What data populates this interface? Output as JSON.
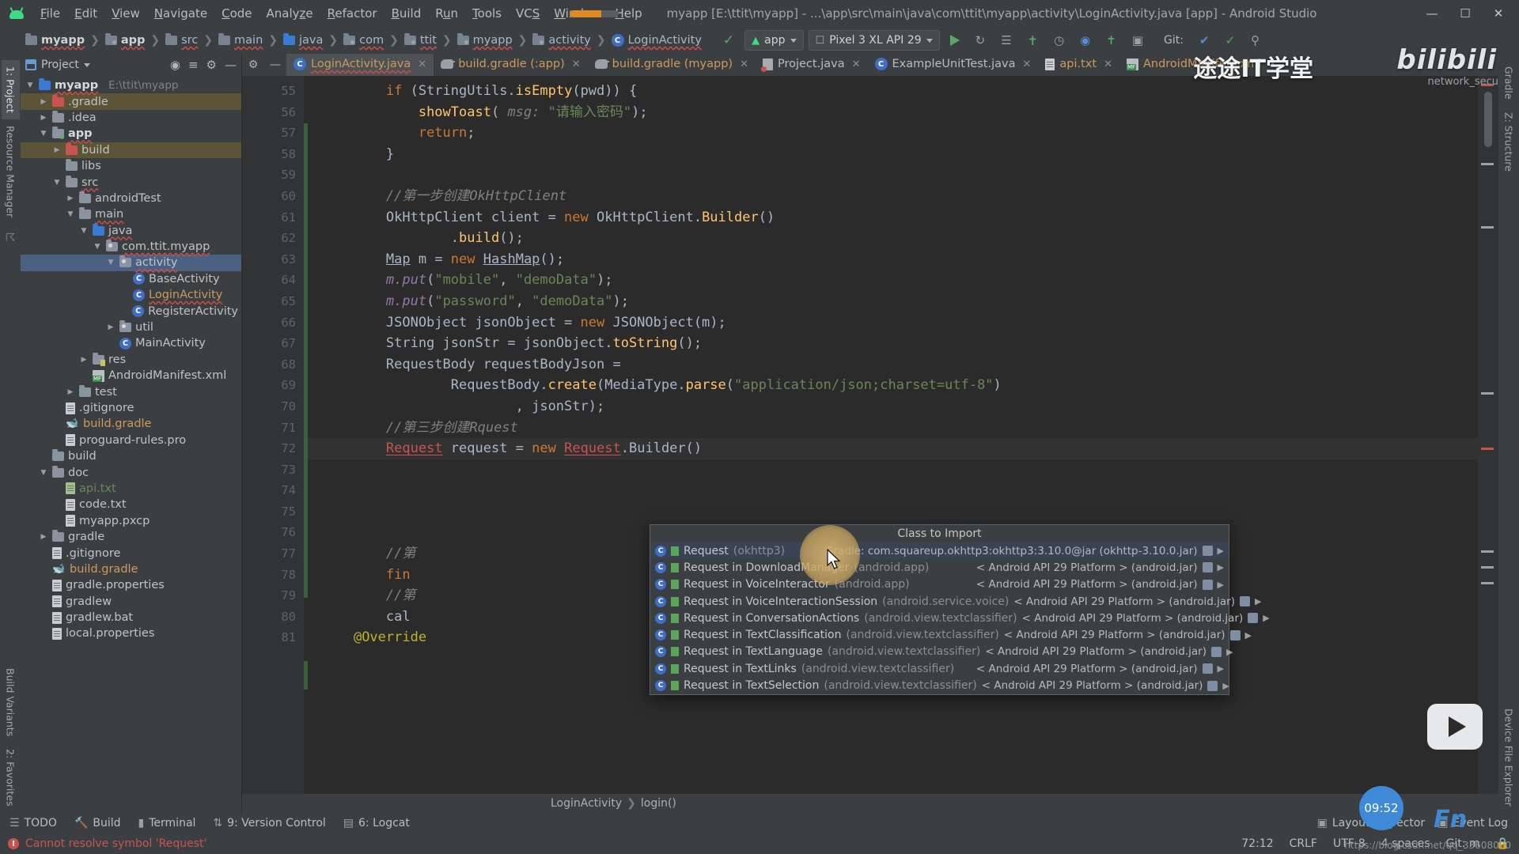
{
  "window": {
    "title": "myapp [E:\\ttit\\myapp] - ...\\app\\src\\main\\java\\com\\ttit\\myapp\\activity\\LoginActivity.java [app] - Android Studio",
    "minimize": "—",
    "maximize": "☐",
    "close": "✕"
  },
  "menu": [
    {
      "label": "File",
      "mn": "F"
    },
    {
      "label": "Edit",
      "mn": "E"
    },
    {
      "label": "View",
      "mn": "V"
    },
    {
      "label": "Navigate",
      "mn": "N"
    },
    {
      "label": "Code",
      "mn": "C"
    },
    {
      "label": "Analyze",
      "mn": "z"
    },
    {
      "label": "Refactor",
      "mn": "R"
    },
    {
      "label": "Build",
      "mn": "B"
    },
    {
      "label": "Run",
      "mn": "u"
    },
    {
      "label": "Tools",
      "mn": "T"
    },
    {
      "label": "VCS",
      "mn": "S"
    },
    {
      "label": "Window",
      "mn": "W"
    },
    {
      "label": "Help",
      "mn": "H"
    }
  ],
  "breadcrumb": [
    {
      "label": "myapp",
      "type": "folder",
      "bold": true
    },
    {
      "label": "app",
      "type": "folder-mod",
      "bold": true
    },
    {
      "label": "src",
      "type": "folder"
    },
    {
      "label": "main",
      "type": "folder"
    },
    {
      "label": "java",
      "type": "folder-blue"
    },
    {
      "label": "com",
      "type": "package"
    },
    {
      "label": "ttit",
      "type": "package"
    },
    {
      "label": "myapp",
      "type": "package"
    },
    {
      "label": "activity",
      "type": "package"
    },
    {
      "label": "LoginActivity",
      "type": "class"
    }
  ],
  "toolbar": {
    "module_selector": "app",
    "device_selector": "Pixel 3 XL API 29",
    "run_icon": "run-icon",
    "debug_icon": "debug-icon",
    "git_label": "Git:",
    "icons": [
      "build-hammer-icon",
      "run-icon",
      "rerun-icon",
      "stop-icon",
      "avd-manager-icon",
      "sdk-manager-icon",
      "profiler-icon",
      "layout-inspector-icon",
      "attach-debugger-icon",
      "sync-gradle-icon",
      "search-icon"
    ]
  },
  "project_panel": {
    "title": "Project",
    "icons": [
      "locate-icon",
      "collapse-all-icon",
      "settings-icon",
      "hide-icon"
    ],
    "tree": [
      {
        "depth": 0,
        "arrow": "▼",
        "icon": "folder-module",
        "label": "myapp",
        "bold": true,
        "path": "E:\\ttit\\myapp",
        "wav": true
      },
      {
        "depth": 1,
        "arrow": "▶",
        "icon": "folder-red",
        "label": ".gradle",
        "highlight": true
      },
      {
        "depth": 1,
        "arrow": "▶",
        "icon": "folder",
        "label": ".idea"
      },
      {
        "depth": 1,
        "arrow": "▼",
        "icon": "folder-mod",
        "label": "app",
        "bold": true,
        "wav": true
      },
      {
        "depth": 2,
        "arrow": "▶",
        "icon": "folder-red",
        "label": "build",
        "highlight": true
      },
      {
        "depth": 2,
        "arrow": "",
        "icon": "folder",
        "label": "libs"
      },
      {
        "depth": 2,
        "arrow": "▼",
        "icon": "folder",
        "label": "src",
        "wav": true
      },
      {
        "depth": 3,
        "arrow": "▶",
        "icon": "folder",
        "label": "androidTest"
      },
      {
        "depth": 3,
        "arrow": "▼",
        "icon": "folder",
        "label": "main",
        "wav": true
      },
      {
        "depth": 4,
        "arrow": "▼",
        "icon": "folder-blue",
        "label": "java",
        "wav": true
      },
      {
        "depth": 5,
        "arrow": "▼",
        "icon": "package",
        "label": "com.ttit.myapp",
        "wav": true
      },
      {
        "depth": 6,
        "arrow": "▼",
        "icon": "package",
        "label": "activity",
        "selected": true,
        "wav": true
      },
      {
        "depth": 7,
        "arrow": "",
        "icon": "class",
        "label": "BaseActivity"
      },
      {
        "depth": 7,
        "arrow": "",
        "icon": "class",
        "label": "LoginActivity",
        "wav": true,
        "open": true
      },
      {
        "depth": 7,
        "arrow": "",
        "icon": "class",
        "label": "RegisterActivity"
      },
      {
        "depth": 6,
        "arrow": "▶",
        "icon": "package",
        "label": "util"
      },
      {
        "depth": 6,
        "arrow": "",
        "icon": "class",
        "label": "MainActivity"
      },
      {
        "depth": 4,
        "arrow": "▶",
        "icon": "folder-res",
        "label": "res"
      },
      {
        "depth": 4,
        "arrow": "",
        "icon": "manifest",
        "label": "AndroidManifest.xml"
      },
      {
        "depth": 3,
        "arrow": "▶",
        "icon": "folder",
        "label": "test"
      },
      {
        "depth": 2,
        "arrow": "",
        "icon": "gitignore",
        "label": ".gitignore"
      },
      {
        "depth": 2,
        "arrow": "",
        "icon": "gradle",
        "label": "build.gradle"
      },
      {
        "depth": 2,
        "arrow": "",
        "icon": "doc",
        "label": "proguard-rules.pro"
      },
      {
        "depth": 1,
        "arrow": "",
        "icon": "folder",
        "label": "build"
      },
      {
        "depth": 1,
        "arrow": "▼",
        "icon": "folder",
        "label": "doc"
      },
      {
        "depth": 2,
        "arrow": "",
        "icon": "doc-green",
        "label": "api.txt"
      },
      {
        "depth": 2,
        "arrow": "",
        "icon": "doc",
        "label": "code.txt"
      },
      {
        "depth": 2,
        "arrow": "",
        "icon": "doc-unknown",
        "label": "myapp.pxcp"
      },
      {
        "depth": 1,
        "arrow": "▶",
        "icon": "folder",
        "label": "gradle"
      },
      {
        "depth": 1,
        "arrow": "",
        "icon": "gitignore",
        "label": ".gitignore"
      },
      {
        "depth": 1,
        "arrow": "",
        "icon": "gradle",
        "label": "build.gradle"
      },
      {
        "depth": 1,
        "arrow": "",
        "icon": "props",
        "label": "gradle.properties"
      },
      {
        "depth": 1,
        "arrow": "",
        "icon": "script",
        "label": "gradlew"
      },
      {
        "depth": 1,
        "arrow": "",
        "icon": "script",
        "label": "gradlew.bat"
      },
      {
        "depth": 1,
        "arrow": "",
        "icon": "props",
        "label": "local.properties"
      }
    ]
  },
  "left_rail": [
    {
      "label": "1: Project",
      "selected": true
    },
    {
      "label": "Resource Manager"
    },
    {
      "label": "Build Variants"
    },
    {
      "label": "2: Favorites"
    }
  ],
  "right_rail": [
    {
      "label": "Gradle"
    },
    {
      "label": "Z: Structure"
    },
    {
      "label": "Device File Explorer"
    }
  ],
  "editor_tabs": [
    {
      "label": "LoginActivity.java",
      "icon": "java-class-icon",
      "active": true,
      "close": "✕"
    },
    {
      "label": "build.gradle (:app)",
      "icon": "gradle-icon",
      "active": false,
      "close": "✕"
    },
    {
      "label": "build.gradle (myapp)",
      "icon": "gradle-icon",
      "active": false,
      "close": "✕"
    },
    {
      "label": "Project.java",
      "icon": "java-file-icon",
      "active": false,
      "close": "✕"
    },
    {
      "label": "ExampleUnitTest.java",
      "icon": "java-test-icon",
      "active": false,
      "close": "✕"
    },
    {
      "label": "api.txt",
      "icon": "text-file-icon",
      "active": false,
      "close": "✕"
    },
    {
      "label": "AndroidManifest.xml",
      "icon": "manifest-icon",
      "active": false,
      "close": "✕"
    }
  ],
  "code": {
    "first_line_number": 55,
    "lines": [
      {
        "n": 55,
        "html": "        <span class=\"kw\">if</span> (StringUtils.<span class=\"meth\">isEmpty</span>(pwd)) {"
      },
      {
        "n": 56,
        "html": "            <span class=\"meth\">showToast</span>( <span class=\"cmt\">msg:</span> <span class=\"str\">\"请输入密码\"</span>);"
      },
      {
        "n": 57,
        "html": "            <span class=\"kw\">return</span>;"
      },
      {
        "n": 58,
        "html": "        }"
      },
      {
        "n": 59,
        "html": ""
      },
      {
        "n": 60,
        "html": "        <span class=\"cmt\">//第一步创建OkHttpClient</span>"
      },
      {
        "n": 61,
        "html": "        OkHttpClient client = <span class=\"kw\">new</span> OkHttpClient.<span class=\"meth\">Builder</span>()"
      },
      {
        "n": 62,
        "html": "                .<span class=\"meth\">build</span>();"
      },
      {
        "n": 63,
        "html": "        <span class=\"stat\">Map</span> m = <span class=\"kw\">new</span> <span class=\"stat\">HashMap</span>();"
      },
      {
        "n": 64,
        "html": "        <span class=\"fld\">m.put</span>(<span class=\"str\">\"mobile\"</span>, <span class=\"str\">\"demoData\"</span>);"
      },
      {
        "n": 65,
        "html": "        <span class=\"fld\">m.put</span>(<span class=\"str\">\"password\"</span>, <span class=\"str\">\"demoData\"</span>);"
      },
      {
        "n": 66,
        "html": "        JSONObject jsonObject = <span class=\"kw\">new</span> JSONObject(m);"
      },
      {
        "n": 67,
        "html": "        String jsonStr = jsonObject.<span class=\"meth\">toString</span>();"
      },
      {
        "n": 68,
        "html": "        RequestBody requestBodyJson ="
      },
      {
        "n": 69,
        "html": "                RequestBody.<span class=\"meth\">create</span>(MediaType.<span class=\"meth\">parse</span>(<span class=\"str\">\"application/json;charset=utf-8\"</span>)"
      },
      {
        "n": 70,
        "html": "                        , jsonStr);"
      },
      {
        "n": 71,
        "html": "        <span class=\"cmt\">//第三步创建Rquest</span>"
      },
      {
        "n": 72,
        "html": "        <span class=\"err\">Request</span> request = <span class=\"kw\">new</span> <span class=\"err\">Request</span>.Builder()",
        "current": true
      },
      {
        "n": 73,
        "html": ""
      },
      {
        "n": 74,
        "html": ""
      },
      {
        "n": 75,
        "html": ""
      },
      {
        "n": 76,
        "html": ""
      },
      {
        "n": 77,
        "html": "        <span class=\"cmt\">//第</span>"
      },
      {
        "n": 78,
        "html": "        <span class=\"kw\">fin</span>"
      },
      {
        "n": 79,
        "html": "        <span class=\"cmt\">//第</span>"
      },
      {
        "n": 80,
        "html": "        cal"
      },
      {
        "n": 81,
        "html": "    <span class=\"anno\">@Override</span>"
      }
    ]
  },
  "popup": {
    "header": "Class to Import",
    "rows": [
      {
        "name": "Request",
        "pkg": " (okhttp3)",
        "right": "Gradle: com.squareup.okhttp3:okhttp3:3.10.0@jar (okhttp-3.10.0.jar)",
        "selected": true
      },
      {
        "name": "Request in DownloadManager",
        "pkg": " (android.app)",
        "right": "< Android API 29 Platform > (android.jar)"
      },
      {
        "name": "Request in VoiceInteractor",
        "pkg": " (android.app)",
        "right": "< Android API 29 Platform > (android.jar)"
      },
      {
        "name": "Request in VoiceInteractionSession",
        "pkg": " (android.service.voice)",
        "right": "< Android API 29 Platform > (android.jar)"
      },
      {
        "name": "Request in ConversationActions",
        "pkg": " (android.view.textclassifier)",
        "right": "< Android API 29 Platform > (android.jar)"
      },
      {
        "name": "Request in TextClassification",
        "pkg": " (android.view.textclassifier)",
        "right": "< Android API 29 Platform > (android.jar)"
      },
      {
        "name": "Request in TextLanguage",
        "pkg": " (android.view.textclassifier)",
        "right": "< Android API 29 Platform > (android.jar)"
      },
      {
        "name": "Request in TextLinks",
        "pkg": " (android.view.textclassifier)",
        "right": "< Android API 29 Platform > (android.jar)"
      },
      {
        "name": "Request in TextSelection",
        "pkg": " (android.view.textclassifier)",
        "right": "< Android API 29 Platform > (android.jar)"
      }
    ]
  },
  "editor_breadcrumb": [
    {
      "label": "LoginActivity"
    },
    {
      "label": "login()"
    }
  ],
  "bottom_tools": [
    {
      "label": "TODO",
      "icon": "todo-icon"
    },
    {
      "label": "Build",
      "icon": "build-icon"
    },
    {
      "label": "Terminal",
      "icon": "terminal-icon"
    },
    {
      "label": "9: Version Control",
      "icon": "vcs-icon"
    },
    {
      "label": "6: Logcat",
      "icon": "logcat-icon"
    }
  ],
  "bottom_tools_right": [
    {
      "label": "Layout Inspector",
      "icon": "layout-inspector-icon"
    },
    {
      "label": "Event Log",
      "icon": "event-log-icon"
    }
  ],
  "status": {
    "message": "Cannot resolve symbol 'Request'",
    "caret": "72:12",
    "line_sep": "CRLF",
    "encoding": "UTF-8",
    "indent": "4 spaces",
    "git_branch": "Git: m"
  },
  "overlays": {
    "channel_cn": "途途IT学堂",
    "brand": "bilibili",
    "network_text": "network_secu",
    "clock": "09:52",
    "fn": "Fn",
    "url": "https://blog.csdn.net/qq_33608000"
  },
  "colors": {
    "accent_orange": "#cc7832",
    "string_green": "#6a8759",
    "error_red": "#c75450",
    "selection_blue": "#4b6182",
    "panel_bg": "#3c3f41",
    "editor_bg": "#2b2b2b"
  }
}
